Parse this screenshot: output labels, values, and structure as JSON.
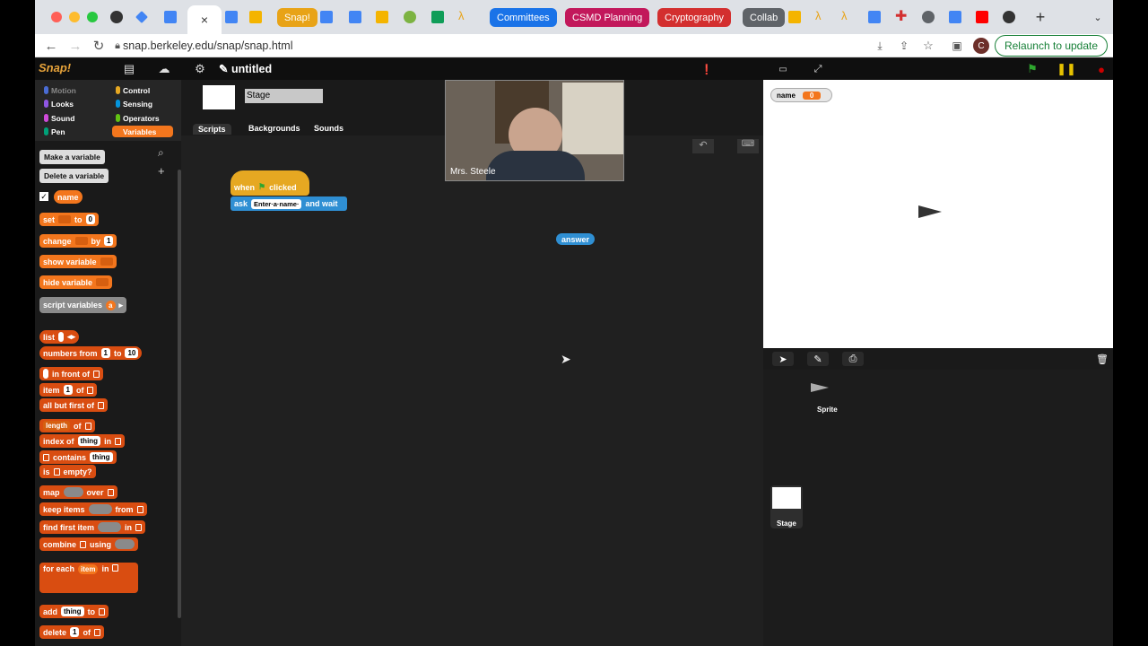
{
  "browser": {
    "tabs": [
      {
        "kind": "group",
        "label": "Snap!",
        "color": "#e8a317"
      },
      {
        "kind": "group",
        "label": "Committees",
        "color": "#1a73e8"
      },
      {
        "kind": "group",
        "label": "CSMD Planning",
        "color": "#c2185b"
      },
      {
        "kind": "group",
        "label": "Cryptography",
        "color": "#d32f2f"
      },
      {
        "kind": "group",
        "label": "Collab",
        "color": "#5f6368"
      }
    ],
    "active_tab_close": "×",
    "new_tab": "+",
    "url": "snap.berkeley.edu/snap/snap.html",
    "relaunch_label": "Relaunch to update",
    "profile_initial": "C"
  },
  "snap": {
    "logo": "Snap!",
    "project_title": "✎ untitled",
    "categories": [
      {
        "label": "Motion",
        "color": "#4a6cd4"
      },
      {
        "label": "Control",
        "color": "#e6a822"
      },
      {
        "label": "Looks",
        "color": "#8f56e3"
      },
      {
        "label": "Sensing",
        "color": "#0494dc"
      },
      {
        "label": "Sound",
        "color": "#cf4ad9"
      },
      {
        "label": "Operators",
        "color": "#62c213"
      },
      {
        "label": "Pen",
        "color": "#00a178"
      },
      {
        "label": "Variables",
        "color": "#f3761d"
      }
    ],
    "palette": {
      "make_variable": "Make a variable",
      "delete_variable": "Delete a variable",
      "var_name": "name",
      "set_label": "set",
      "to_label": "to",
      "set_value": "0",
      "change_label": "change",
      "by_label": "by",
      "change_value": "1",
      "show_variable": "show variable",
      "hide_variable": "hide variable",
      "script_variables": "script variables",
      "script_var_a": "a",
      "list": "list",
      "numbers_from": "numbers from",
      "num_from_val": "1",
      "num_to": "to",
      "num_to_val": "10",
      "in_front_of": "in front of",
      "item": "item",
      "item_val": "1",
      "of": "of",
      "all_but_first": "all but first of",
      "length": "length",
      "index_of": "index of",
      "thing": "thing",
      "in": "in",
      "contains": "contains",
      "is_empty": "is",
      "empty": "empty?",
      "map": "map",
      "over": "over",
      "keep_items": "keep items",
      "from": "from",
      "find_first_item": "find first item",
      "combine": "combine",
      "using": "using",
      "for_each": "for each",
      "for_item": "item",
      "add": "add",
      "delete": "delete"
    },
    "sprite_name_field": "Stage",
    "editor_tabs": [
      "Scripts",
      "Backgrounds",
      "Sounds"
    ],
    "script": {
      "hat_when": "when",
      "hat_clicked": "clicked",
      "ask": "ask",
      "ask_value": "Enter·a·name·",
      "and_wait": "and wait"
    },
    "answer_reporter": "answer",
    "video_caption": "Mrs. Steele",
    "stage_watcher": {
      "name": "name",
      "value": "0"
    },
    "corral": {
      "sprite_label": "Sprite",
      "stage_label": "Stage"
    }
  }
}
